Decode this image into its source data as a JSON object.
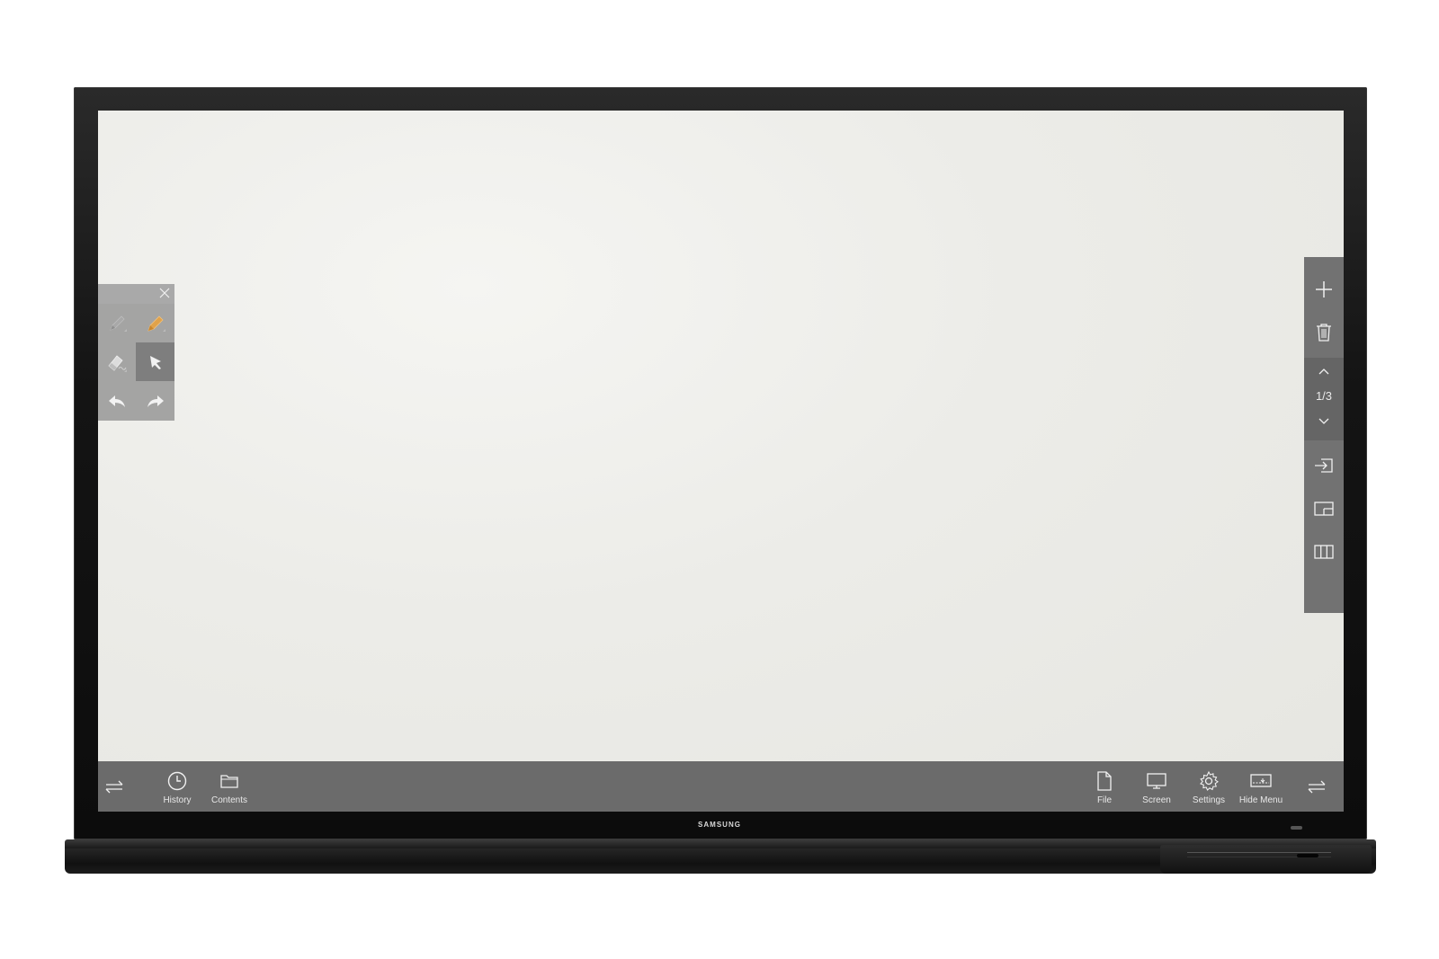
{
  "device": {
    "brand": "SAMSUNG"
  },
  "tool_palette": {
    "tools": [
      {
        "name": "pen",
        "icon": "pen-icon",
        "active": false
      },
      {
        "name": "highlighter",
        "icon": "highlighter-icon",
        "active": false
      },
      {
        "name": "eraser",
        "icon": "eraser-icon",
        "active": false
      },
      {
        "name": "select",
        "icon": "select-arrow-icon",
        "active": true
      },
      {
        "name": "undo",
        "icon": "undo-icon",
        "active": false
      },
      {
        "name": "redo",
        "icon": "redo-icon",
        "active": false
      }
    ]
  },
  "side_panel": {
    "page_indicator": "1/3"
  },
  "bottom_bar": {
    "left_items": [
      {
        "label": "History",
        "icon": "clock-icon"
      },
      {
        "label": "Contents",
        "icon": "folder-icon"
      }
    ],
    "right_items": [
      {
        "label": "File",
        "icon": "file-icon"
      },
      {
        "label": "Screen",
        "icon": "monitor-icon"
      },
      {
        "label": "Settings",
        "icon": "gear-icon"
      },
      {
        "label": "Hide Menu",
        "icon": "hide-menu-icon"
      }
    ]
  },
  "colors": {
    "canvas": "#ecece8",
    "toolbar": "#6b6b6b",
    "side_panel": "#727272",
    "highlighter_accent": "#e0a24a"
  }
}
